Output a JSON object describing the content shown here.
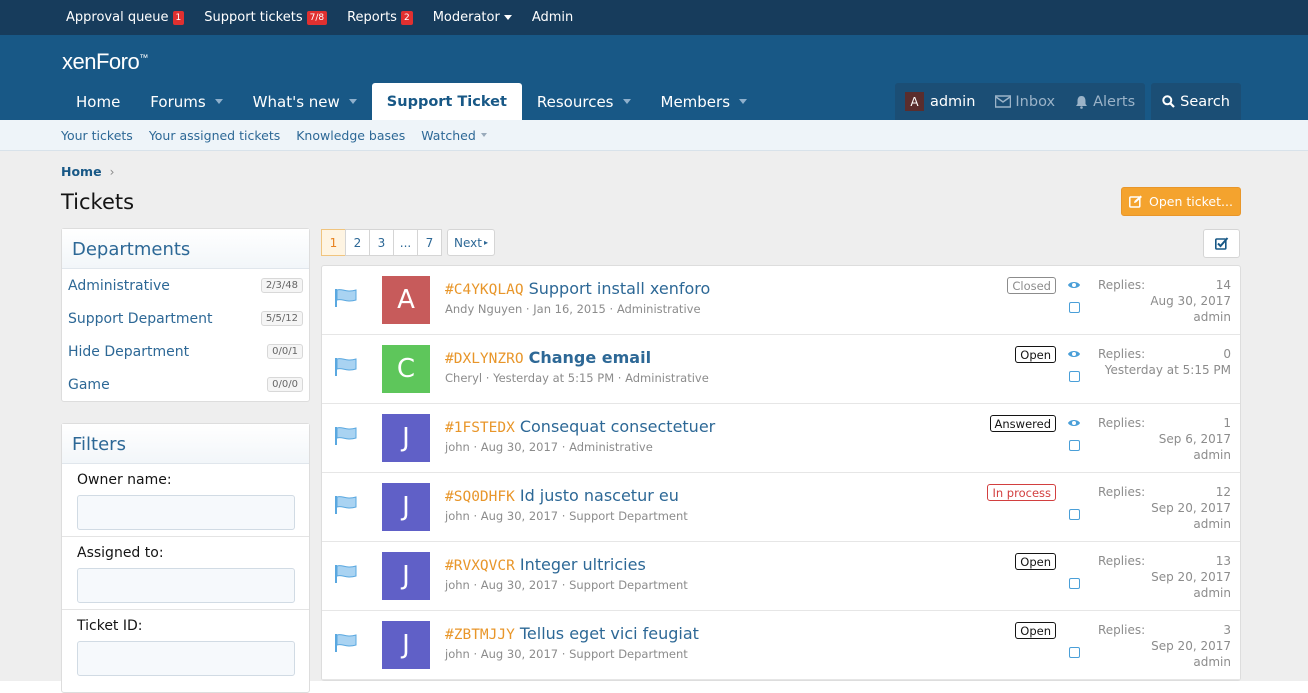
{
  "staff_bar": {
    "items": [
      {
        "label": "Approval queue",
        "badge": "1"
      },
      {
        "label": "Support tickets",
        "badge": "7/8"
      },
      {
        "label": "Reports",
        "badge": "2"
      },
      {
        "label": "Moderator",
        "badge": null
      },
      {
        "label": "Admin",
        "badge": null
      }
    ]
  },
  "header": {
    "logo": "xenForo",
    "logo_mark": "™",
    "nav": [
      {
        "label": "Home"
      },
      {
        "label": "Forums"
      },
      {
        "label": "What's new"
      },
      {
        "label": "Support Ticket"
      },
      {
        "label": "Resources"
      },
      {
        "label": "Members"
      }
    ],
    "account": {
      "avatar_letter": "A",
      "username": "admin",
      "inbox": "Inbox",
      "alerts": "Alerts"
    },
    "search": "Search"
  },
  "subnav": [
    "Your tickets",
    "Your assigned tickets",
    "Knowledge bases",
    "Watched"
  ],
  "breadcrumb": {
    "home": "Home",
    "sep": "›"
  },
  "page_title": "Tickets",
  "open_ticket_button": "Open ticket...",
  "departments": {
    "title": "Departments",
    "items": [
      {
        "name": "Administrative",
        "count": "2/3/48"
      },
      {
        "name": "Support Department",
        "count": "5/5/12"
      },
      {
        "name": "Hide Department",
        "count": "0/0/1"
      },
      {
        "name": "Game",
        "count": "0/0/0"
      }
    ]
  },
  "filters": {
    "title": "Filters",
    "owner_label": "Owner name:",
    "assigned_label": "Assigned to:",
    "ticket_id_label": "Ticket ID:"
  },
  "pager": {
    "pages": [
      "1",
      "2",
      "3",
      "...",
      "7"
    ],
    "next": "Next"
  },
  "tickets": [
    {
      "id": "#C4YKQLAQ",
      "title": "Support install xenforo",
      "author": "Andy Nguyen",
      "date": "Jan 16, 2015",
      "department": "Administrative",
      "status": "Closed",
      "replies_label": "Replies:",
      "replies": "14",
      "last_date": "Aug 30, 2017",
      "last_user": "admin",
      "avatar": "A",
      "avatar_color": "#c75b5b",
      "unread": false,
      "watched": true
    },
    {
      "id": "#DXLYNZRO",
      "title": "Change email",
      "author": "Cheryl",
      "date": "Yesterday at 5:15 PM",
      "department": "Administrative",
      "status": "Open",
      "replies_label": "Replies:",
      "replies": "0",
      "last_date": "Yesterday at 5:15 PM",
      "last_user": "",
      "avatar": "C",
      "avatar_color": "#5ec65b",
      "unread": true,
      "watched": true
    },
    {
      "id": "#1FSTEDX",
      "title": "Consequat consectetuer",
      "author": "john",
      "date": "Aug 30, 2017",
      "department": "Administrative",
      "status": "Answered",
      "replies_label": "Replies:",
      "replies": "1",
      "last_date": "Sep 6, 2017",
      "last_user": "admin",
      "avatar": "J",
      "avatar_color": "#6060c7",
      "unread": false,
      "watched": true
    },
    {
      "id": "#SQ0DHFK",
      "title": "Id justo nascetur eu",
      "author": "john",
      "date": "Aug 30, 2017",
      "department": "Support Department",
      "status": "In process",
      "replies_label": "Replies:",
      "replies": "12",
      "last_date": "Sep 20, 2017",
      "last_user": "admin",
      "avatar": "J",
      "avatar_color": "#6060c7",
      "unread": false,
      "watched": false
    },
    {
      "id": "#RVXQVCR",
      "title": "Integer ultricies",
      "author": "john",
      "date": "Aug 30, 2017",
      "department": "Support Department",
      "status": "Open",
      "replies_label": "Replies:",
      "replies": "13",
      "last_date": "Sep 20, 2017",
      "last_user": "admin",
      "avatar": "J",
      "avatar_color": "#6060c7",
      "unread": false,
      "watched": false
    },
    {
      "id": "#ZBTMJJY",
      "title": "Tellus eget vici feugiat",
      "author": "john",
      "date": "Aug 30, 2017",
      "department": "Support Department",
      "status": "Open",
      "replies_label": "Replies:",
      "replies": "3",
      "last_date": "Sep 20, 2017",
      "last_user": "admin",
      "avatar": "J",
      "avatar_color": "#6060c7",
      "unread": false,
      "watched": false
    }
  ],
  "status_colors": {
    "Closed": "#8c8c8c",
    "Open": "#141414",
    "Answered": "#141414",
    "In process": "#d23f3f"
  },
  "colors": {
    "header": "#185886",
    "staff_bar": "#173c5c",
    "accent": "#f4a32e",
    "link": "#2d6896"
  }
}
